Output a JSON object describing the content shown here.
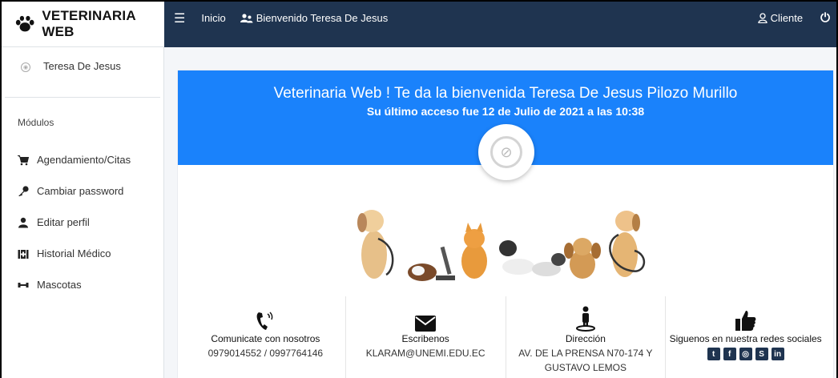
{
  "brand": {
    "title": "VETERINARIA WEB"
  },
  "topnav": {
    "home_label": "Inicio",
    "welcome_label": "Bienvenido Teresa De Jesus",
    "client_label": "Cliente"
  },
  "sidebar": {
    "user_name": "Teresa De Jesus",
    "modules_header": "Módulos",
    "items": [
      {
        "label": "Agendamiento/Citas",
        "icon": "cart-icon"
      },
      {
        "label": "Cambiar password",
        "icon": "key-icon"
      },
      {
        "label": "Editar perfil",
        "icon": "user-icon"
      },
      {
        "label": "Historial Médico",
        "icon": "medkit-icon"
      },
      {
        "label": "Mascotas",
        "icon": "dumbbell-icon"
      }
    ]
  },
  "main": {
    "welcome": "Veterinaria Web ! Te da la bienvenida Teresa De Jesus Pilozo Murillo",
    "last_access": "Su último acceso fue 12 de Julio de 2021 a las 10:38",
    "contact": {
      "title": "Comunicate con nosotros",
      "value": "0979014552 / 0997764146"
    },
    "email": {
      "title": "Escribenos",
      "value": "KLARAM@UNEMI.EDU.EC"
    },
    "address": {
      "title": "Dirección",
      "value": "AV. DE LA PRENSA N70-174 Y GUSTAVO LEMOS"
    },
    "social": {
      "title": "Siguenos en nuestra redes sociales",
      "networks": [
        "twitter-icon",
        "facebook-icon",
        "instagram-icon",
        "skype-icon",
        "linkedin-icon"
      ]
    }
  },
  "colors": {
    "navbar": "#1f3450",
    "header_blue": "#1a82fb"
  }
}
